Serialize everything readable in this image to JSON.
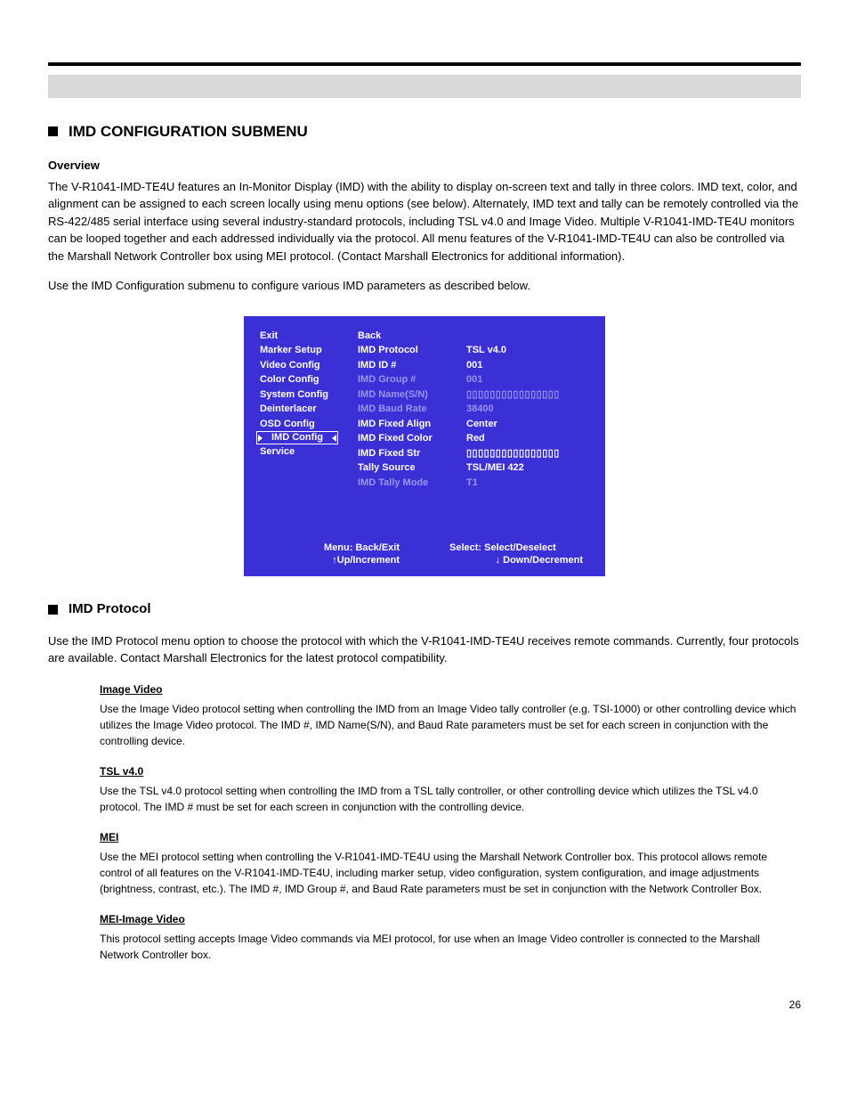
{
  "section1": {
    "title": "IMD CONFIGURATION SUBMENU",
    "overview_h": "Overview",
    "p1": "The V-R1041-IMD-TE4U features an In-Monitor Display (IMD) with the ability to display on-screen text and tally in three colors. IMD text, color, and alignment can be assigned to each screen locally using menu options (see below). Alternately, IMD text and tally can be remotely controlled via the RS-422/485 serial interface using several industry-standard protocols, including TSL v4.0 and Image Video. Multiple V-R1041-IMD-TE4U monitors can be looped together and each addressed individually via the protocol. All menu features of the V-R1041-IMD-TE4U can also be controlled via the Marshall Network Controller box using MEI protocol. (Contact Marshall Electronics for additional information).",
    "p2": "Use the IMD Configuration submenu to configure various IMD parameters as described below."
  },
  "menu": {
    "left": [
      "Exit",
      "Marker Setup",
      "Video Config",
      "Color Config",
      "System Config",
      "Deinterlacer",
      "OSD Config",
      "IMD Config",
      "Service"
    ],
    "mid": {
      "back": "Back",
      "items": [
        {
          "label": "IMD Protocol",
          "value": "TSL v4.0",
          "dim": false
        },
        {
          "label": "IMD ID #",
          "value": "001",
          "dim": false
        },
        {
          "label": "IMD Group #",
          "value": "001",
          "dim": true
        },
        {
          "label": "IMD Name(S/N)",
          "value": "▯▯▯▯▯▯▯▯▯▯▯▯▯▯▯▯",
          "dim": true
        },
        {
          "label": "IMD Baud Rate",
          "value": "38400",
          "dim": true
        },
        {
          "label": "IMD Fixed Align",
          "value": "Center",
          "dim": false
        },
        {
          "label": "IMD Fixed Color",
          "value": "Red",
          "dim": false
        },
        {
          "label": "IMD Fixed Str",
          "value": "▯▯▯▯▯▯▯▯▯▯▯▯▯▯▯▯",
          "dim": false
        },
        {
          "label": "Tally Source",
          "value": "TSL/MEI 422",
          "dim": false
        },
        {
          "label": "IMD Tally Mode",
          "value": "T1",
          "dim": true
        }
      ]
    },
    "footer": {
      "menu": "Menu: Back/Exit",
      "select": "Select: Select/Deselect",
      "up": "↑Up/Increment",
      "down": "↓ Down/Decrement"
    },
    "selected_label": "IMD Config"
  },
  "section2": {
    "title": "IMD Protocol",
    "intro": "Use the IMD Protocol menu option to choose the protocol with which the V-R1041-IMD-TE4U receives remote commands. Currently, four protocols are available. Contact Marshall Electronics for the latest protocol compatibility.",
    "proto1_h": "Image Video",
    "proto1_p": "Use the Image Video protocol setting when controlling the IMD from an Image Video tally controller (e.g. TSI-1000) or other controlling device which utilizes the Image Video protocol. The IMD #, IMD Name(S/N), and Baud Rate parameters must be set for each screen in conjunction with the controlling device.",
    "proto2_h": "TSL v4.0",
    "proto2_p": "Use the TSL v4.0 protocol setting when controlling the IMD from a TSL tally controller, or other controlling device which utilizes the TSL v4.0 protocol. The IMD # must be set for each screen in conjunction with the controlling device.",
    "proto3_h": "MEI",
    "proto3_p": "Use the MEI protocol setting when controlling the V-R1041-IMD-TE4U using the Marshall Network Controller box. This protocol allows remote control of all features on the V-R1041-IMD-TE4U, including marker setup, video configuration, system configuration, and image adjustments (brightness, contrast, etc.). The IMD #, IMD Group #, and Baud Rate parameters must be set in conjunction with the Network Controller Box.",
    "proto4_h": "MEI-Image Video",
    "proto4_p": "This protocol setting accepts Image Video commands via MEI protocol, for use when an Image Video controller is connected to the Marshall Network Controller box."
  },
  "page_num": "26"
}
